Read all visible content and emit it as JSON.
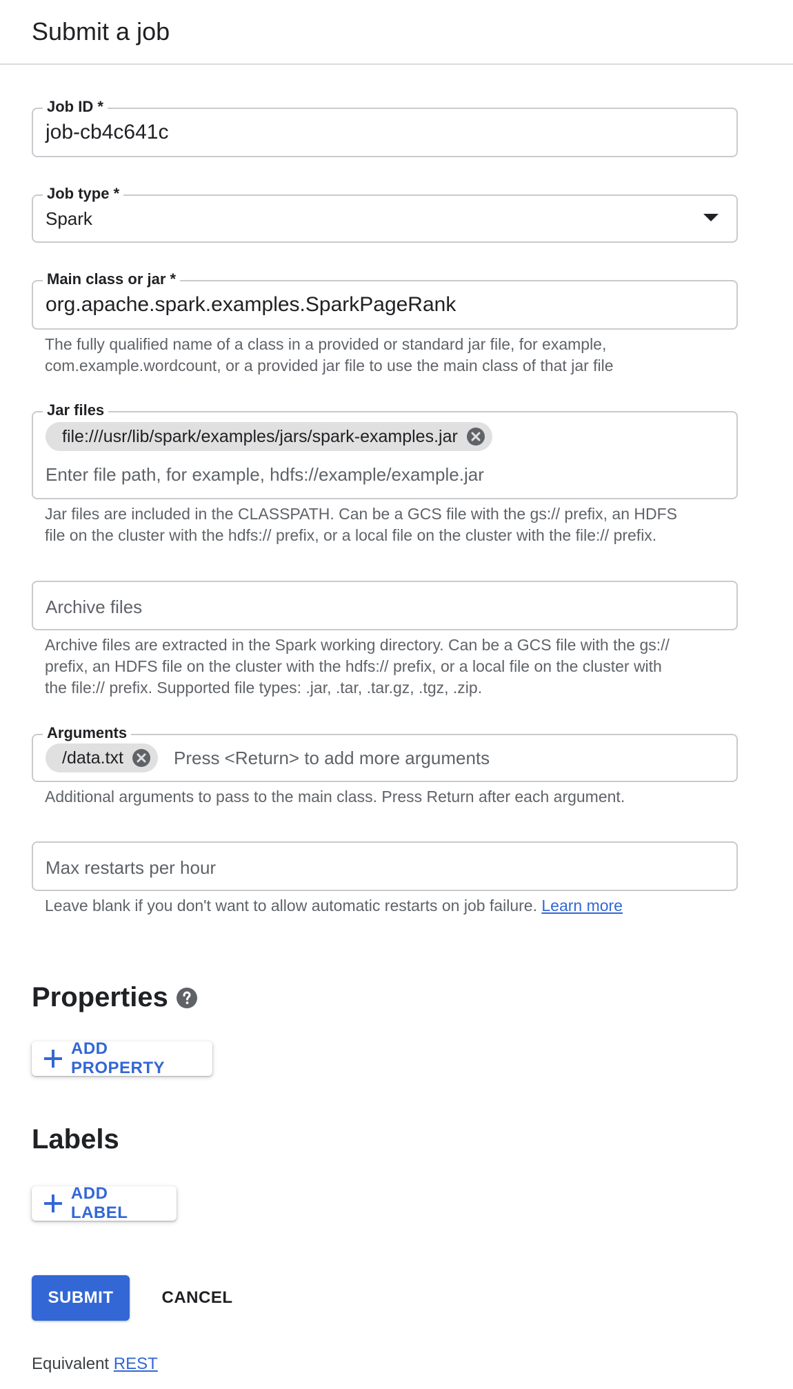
{
  "header": {
    "title": "Submit a job"
  },
  "job_id": {
    "label": "Job ID *",
    "value": "job-cb4c641c"
  },
  "job_type": {
    "label": "Job type *",
    "value": "Spark"
  },
  "main_class": {
    "label": "Main class or jar *",
    "value": "org.apache.spark.examples.SparkPageRank",
    "helper_line1": "The fully qualified name of a class in a provided or standard jar file, for example,",
    "helper_line2": "com.example.wordcount, or a provided jar file to use the main class of that jar file"
  },
  "jar_files": {
    "label": "Jar files",
    "chips": [
      "file:///usr/lib/spark/examples/jars/spark-examples.jar"
    ],
    "placeholder": "Enter file path, for example, hdfs://example/example.jar",
    "helper_line1": "Jar files are included in the CLASSPATH. Can be a GCS file with the gs:// prefix, an HDFS",
    "helper_line2": "file on the cluster with the hdfs:// prefix, or a local file on the cluster with the file:// prefix."
  },
  "archive_files": {
    "placeholder": "Archive files",
    "helper_line1": "Archive files are extracted in the Spark working directory. Can be a GCS file with the gs://",
    "helper_line2": "prefix, an HDFS file on the cluster with the hdfs:// prefix, or a local file on the cluster with",
    "helper_line3": "the file:// prefix. Supported file types: .jar, .tar, .tar.gz, .tgz, .zip."
  },
  "arguments": {
    "label": "Arguments",
    "chips": [
      "/data.txt"
    ],
    "placeholder": "Press <Return> to add more arguments",
    "helper": "Additional arguments to pass to the main class. Press Return after each argument."
  },
  "max_restarts": {
    "placeholder": "Max restarts per hour",
    "helper": "Leave blank if you don't want to allow automatic restarts on job failure.",
    "learn_more": "Learn more"
  },
  "properties": {
    "title": "Properties",
    "add_label": "ADD PROPERTY"
  },
  "labels": {
    "title": "Labels",
    "add_label": "ADD LABEL"
  },
  "actions": {
    "submit": "SUBMIT",
    "cancel": "CANCEL"
  },
  "footer": {
    "prefix": "Equivalent",
    "link": "REST"
  },
  "colors": {
    "primary": "#3367d6",
    "chip_bg": "#e0e0e0",
    "border": "#c8cacd",
    "helper_text": "#5f6368"
  }
}
